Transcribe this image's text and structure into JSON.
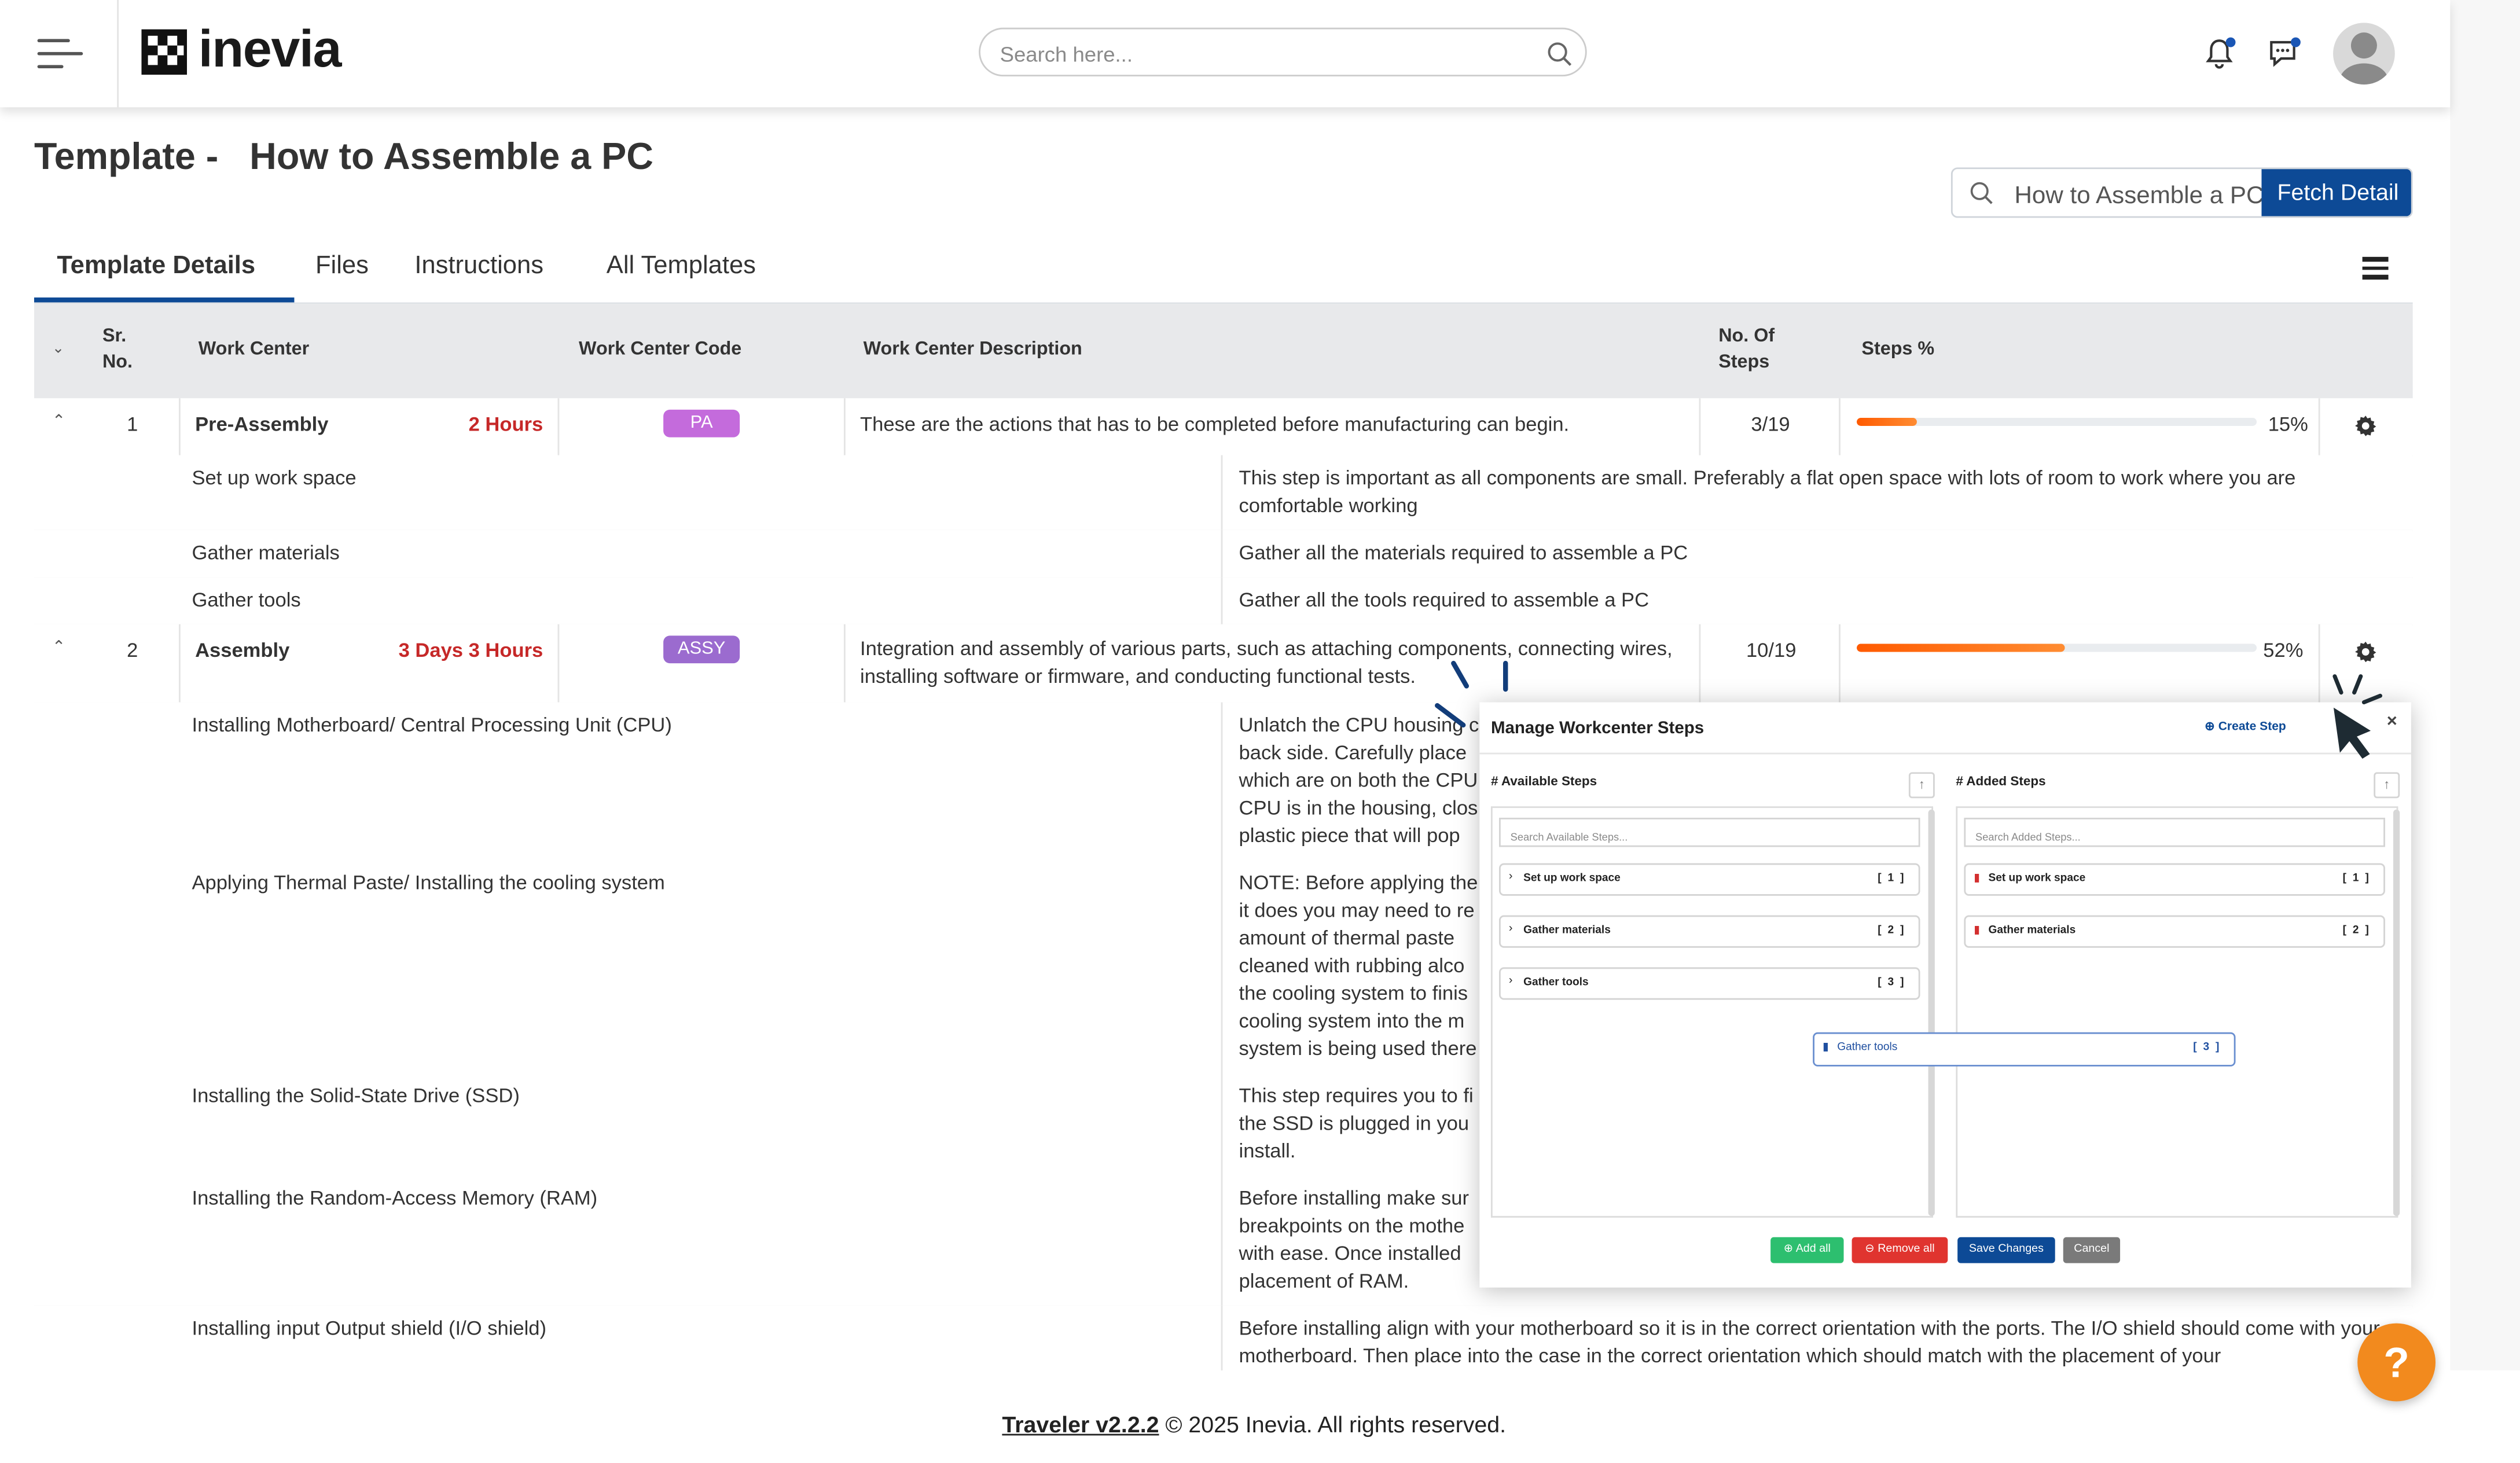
{
  "header": {
    "brand": "inevia",
    "search_placeholder": "Search here..."
  },
  "page": {
    "title": "Template -   How to Assemble a PC",
    "fetch_value": "How to Assemble a PC",
    "fetch_button": "Fetch Detail"
  },
  "tabs": [
    "Template Details",
    "Files",
    "Instructions",
    "All Templates"
  ],
  "table": {
    "headers": {
      "sr": "Sr. No.",
      "work_center": "Work Center",
      "code": "Work Center Code",
      "description": "Work Center Description",
      "steps": "No. Of Steps",
      "steps_pct": "Steps %"
    },
    "groups": [
      {
        "sr": "1",
        "name": "Pre-Assembly",
        "duration": "2 Hours",
        "code": "PA",
        "code_color": "#c46bdc",
        "description": "These are the actions that has to be completed before manufacturing can begin.",
        "steps": "3/19",
        "percent_label": "15%",
        "percent": 15,
        "step_rows": [
          {
            "name": "Set up work space",
            "desc": "This step is important as all components are small. Preferably a flat open space with lots of room to work where you are comfortable working"
          },
          {
            "name": "Gather materials",
            "desc": "Gather all the materials required to assemble a PC"
          },
          {
            "name": "Gather tools",
            "desc": "Gather all the tools required to assemble a PC"
          }
        ]
      },
      {
        "sr": "2",
        "name": "Assembly",
        "duration": "3 Days 3 Hours",
        "code": "ASSY",
        "code_color": "#9b6bcf",
        "description": "Integration and assembly of various parts, such as attaching components, connecting wires, installing software or firmware, and conducting functional tests.",
        "steps": "10/19",
        "percent_label": "52%",
        "percent": 52,
        "step_rows": [
          {
            "name": "Installing Motherboard/ Central Processing Unit (CPU)",
            "desc": "Unlatch the CPU housing c back side. Carefully place which are on both the CPU CPU is in the housing, clos plastic piece that will pop"
          },
          {
            "name": "Applying Thermal Paste/ Installing the cooling system",
            "desc": "NOTE: Before applying the it does you may need to re amount of thermal paste cleaned with rubbing alco the cooling system to finis cooling system into the m system is being used there"
          },
          {
            "name": "Installing the Solid-State Drive (SSD)",
            "desc": "This step requires you to fi the SSD is plugged in you install."
          },
          {
            "name": "Installing the Random-Access Memory (RAM)",
            "desc": "Before installing make sur breakpoints on the mothe with ease. Once installed placement of RAM."
          },
          {
            "name": "Installing input Output shield (I/O shield)",
            "desc": "Before installing align with your motherboard so it is in the correct orientation with the ports. The I/O shield should come with your motherboard. Then place into the case in the correct orientation which should match with the placement of your"
          }
        ]
      }
    ]
  },
  "modal": {
    "title": "Manage Workcenter Steps",
    "create_step": "Create Step",
    "close": "×",
    "available_title": "# Available Steps",
    "added_title": "# Added Steps",
    "available_placeholder": "Search Available Steps...",
    "added_placeholder": "Search Added Steps...",
    "available": [
      {
        "label": "Set up work space",
        "count": "[ 1 ]"
      },
      {
        "label": "Gather materials",
        "count": "[ 2 ]"
      },
      {
        "label": "Gather tools",
        "count": "[ 3 ]"
      }
    ],
    "added": [
      {
        "label": "Set up work space",
        "count": "[ 1 ]"
      },
      {
        "label": "Gather materials",
        "count": "[ 2 ]"
      }
    ],
    "dragging": {
      "label": "Gather tools",
      "count": "[ 3 ]"
    },
    "buttons": {
      "add_all": "Add all",
      "remove_all": "Remove all",
      "save": "Save Changes",
      "cancel": "Cancel"
    }
  },
  "footer": {
    "version": "Traveler v2.2.2",
    "copyright": " © 2025 Inevia. All rights reserved."
  },
  "help": "?",
  "colors": {
    "primary": "#0d4a96",
    "accent_red": "#c62828",
    "progress": "#ff6a10",
    "help": "#f28a1e"
  }
}
